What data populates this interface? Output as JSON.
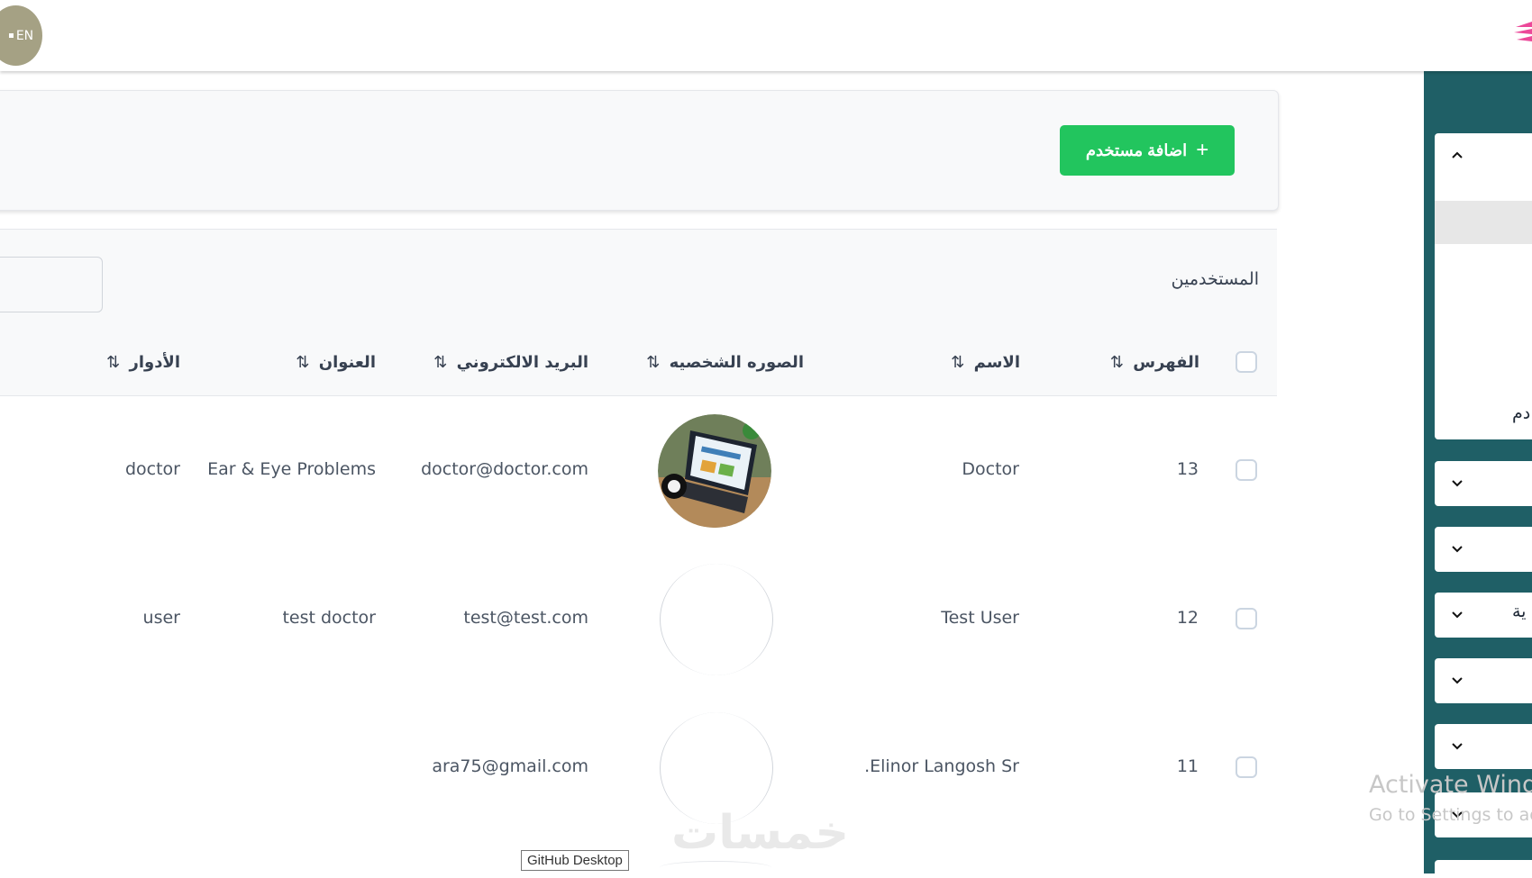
{
  "header": {
    "lang_label": "EN"
  },
  "toolbar": {
    "add_user_label": "اضافة مستخدم",
    "add_user_icon": "plus-icon"
  },
  "table": {
    "title": "المستخدمين",
    "columns": [
      "الفهرس",
      "الاسم",
      "الصوره الشخصيه",
      "البريد الالكتروني",
      "العنوان",
      "الأدوار"
    ],
    "sort_icon": "⇅",
    "rows": [
      {
        "index": "13",
        "name": "Doctor",
        "email": "doctor@doctor.com",
        "address": "Ear & Eye Problems",
        "role": "doctor",
        "avatar": "front-end-developer-laptop"
      },
      {
        "index": "12",
        "name": "Test User",
        "email": "test@test.com",
        "address": "test doctor",
        "role": "user",
        "avatar": "broken-image"
      },
      {
        "index": "11",
        "name": "Elinor Langosh Sr.",
        "email": "ara75@gmail.com",
        "address": "",
        "role": "",
        "avatar": "broken-image"
      }
    ]
  },
  "sidebar": {
    "partial_labels": [
      "دم",
      "ية"
    ]
  },
  "os_overlay": {
    "activate_title": "Activate Windo",
    "activate_sub": "Go to Settings to act",
    "tooltip": "GitHub Desktop",
    "site_watermark": "خمسات"
  },
  "colors": {
    "accent_green": "#22c55e",
    "sidebar_teal": "#1f5f66",
    "lang_badge": "#a5a184"
  }
}
